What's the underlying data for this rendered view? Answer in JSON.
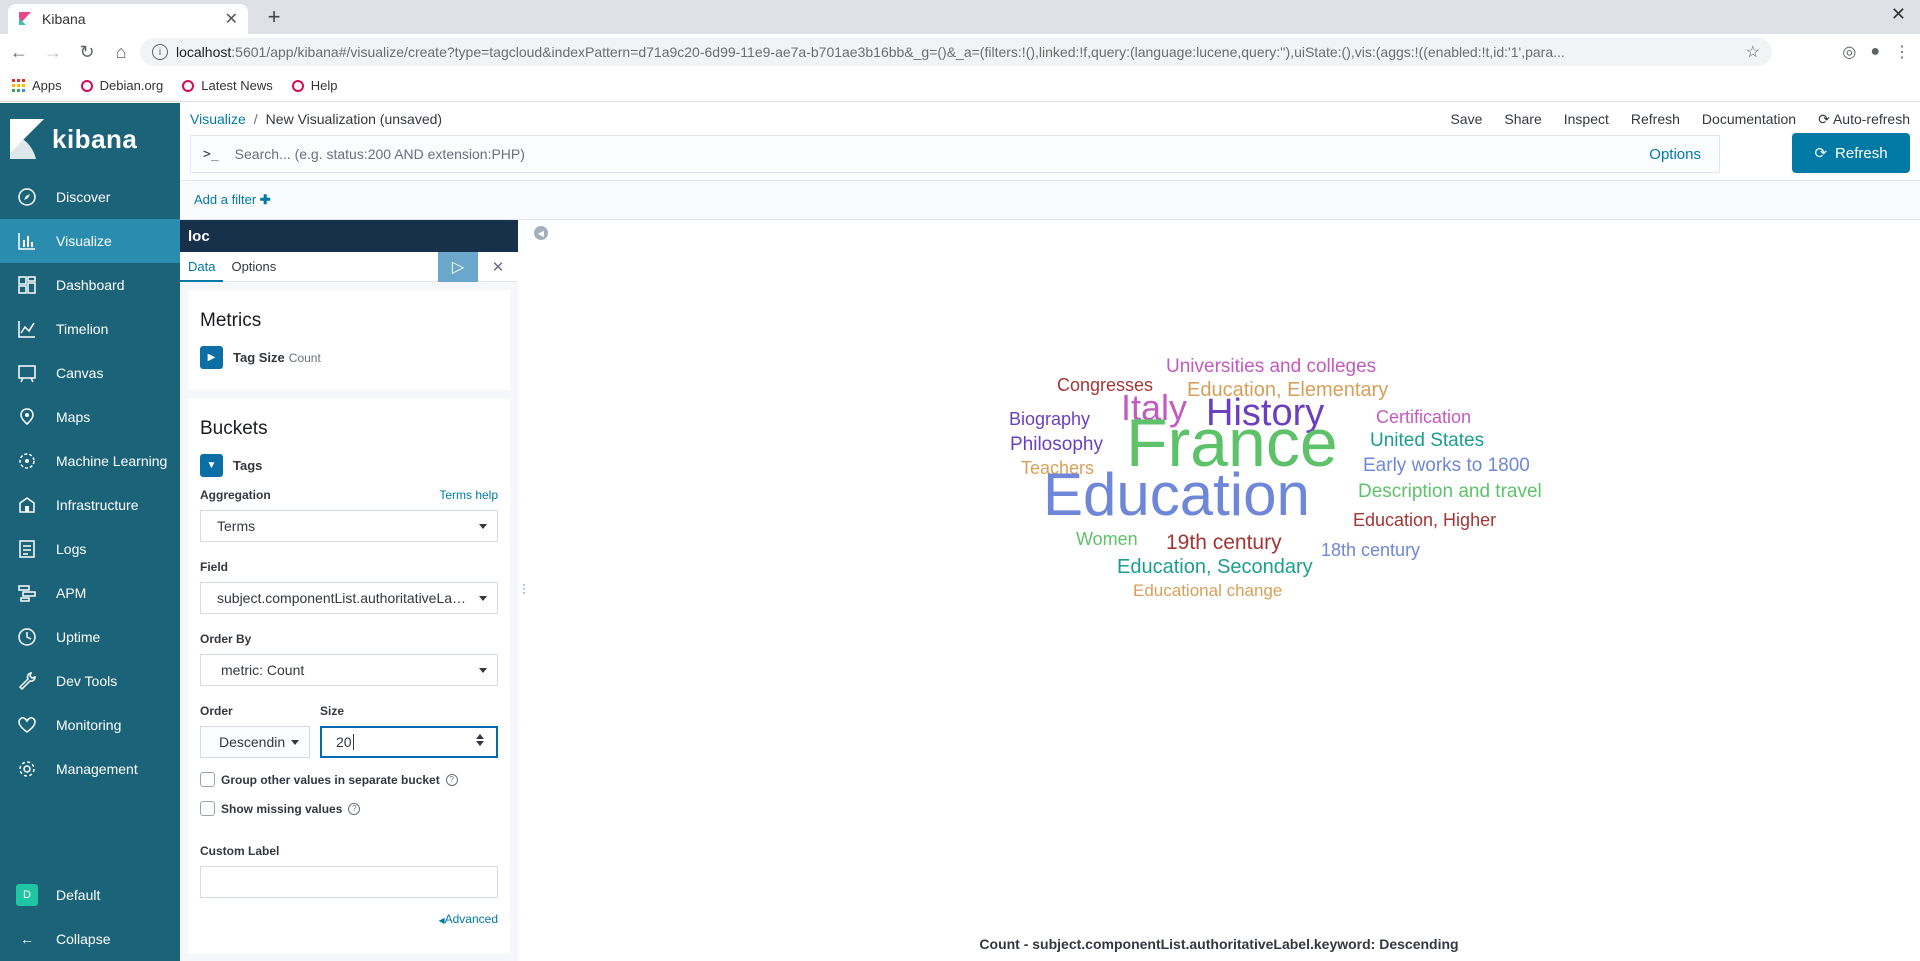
{
  "browser": {
    "tab_title": "Kibana",
    "new_tab": "+",
    "url_host": "localhost",
    "url_rest": ":5601/app/kibana#/visualize/create?type=tagcloud&indexPattern=d71a9c20-6d99-11e9-ae7a-b701ae3b16bb&_g=()&_a=(filters:!(),linked:!f,query:(language:lucene,query:''),uiState:(),vis:(aggs:!((enabled:!t,id:'1',para...",
    "bookmarks": [
      "Apps",
      "Debian.org",
      "Latest News",
      "Help"
    ]
  },
  "kibana": {
    "logo_text": "kibana",
    "nav": [
      {
        "label": "Discover",
        "icon": "compass-icon"
      },
      {
        "label": "Visualize",
        "icon": "visualize-icon"
      },
      {
        "label": "Dashboard",
        "icon": "dashboard-icon"
      },
      {
        "label": "Timelion",
        "icon": "timelion-icon"
      },
      {
        "label": "Canvas",
        "icon": "canvas-icon"
      },
      {
        "label": "Maps",
        "icon": "maps-icon"
      },
      {
        "label": "Machine Learning",
        "icon": "ml-icon"
      },
      {
        "label": "Infrastructure",
        "icon": "infra-icon"
      },
      {
        "label": "Logs",
        "icon": "logs-icon"
      },
      {
        "label": "APM",
        "icon": "apm-icon"
      },
      {
        "label": "Uptime",
        "icon": "uptime-icon"
      },
      {
        "label": "Dev Tools",
        "icon": "wrench-icon"
      },
      {
        "label": "Monitoring",
        "icon": "heartbeat-icon"
      },
      {
        "label": "Management",
        "icon": "gear-icon"
      }
    ],
    "space_label": "Default",
    "space_initial": "D",
    "collapse_label": "Collapse"
  },
  "header": {
    "breadcrumb_root": "Visualize",
    "breadcrumb_sep": "/",
    "breadcrumb_current": "New Visualization (unsaved)",
    "menu": [
      "Save",
      "Share",
      "Inspect",
      "Refresh",
      "Documentation"
    ],
    "auto_refresh": "Auto-refresh",
    "query_prompt": ">_",
    "query_placeholder": "Search... (e.g. status:200 AND extension:PHP)",
    "options": "Options",
    "refresh_button": "Refresh",
    "add_filter": "Add a filter"
  },
  "editor": {
    "index_title": "loc",
    "tabs": [
      "Data",
      "Options"
    ],
    "metrics_heading": "Metrics",
    "metric_label": "Tag Size",
    "metric_agg": "Count",
    "buckets_heading": "Buckets",
    "bucket_label": "Tags",
    "aggregation_label": "Aggregation",
    "terms_help": "Terms help",
    "aggregation_value": "Terms",
    "field_label": "Field",
    "field_value": "subject.componentList.authoritativeLabel.keyword",
    "order_by_label": "Order By",
    "order_by_value": "metric: Count",
    "order_label": "Order",
    "order_value": "Descending",
    "size_label": "Size",
    "size_value": "20",
    "group_other_label": "Group other values in separate bucket",
    "show_missing_label": "Show missing values",
    "custom_label_label": "Custom Label",
    "custom_label_value": "",
    "advanced_link": "Advanced"
  },
  "tagcloud": {
    "words": [
      {
        "text": "Universities and colleges",
        "color": "#c35ac0"
      },
      {
        "text": "Congresses",
        "color": "#a33535"
      },
      {
        "text": "Education, Elementary",
        "color": "#d6a05a"
      },
      {
        "text": "Italy",
        "color": "#c35ac0"
      },
      {
        "text": "History",
        "color": "#6c3fbf"
      },
      {
        "text": "Biography",
        "color": "#6c3fbf"
      },
      {
        "text": "Certification",
        "color": "#c35ac0"
      },
      {
        "text": "United States",
        "color": "#1b9e91"
      },
      {
        "text": "Philosophy",
        "color": "#6c3fbf"
      },
      {
        "text": "France",
        "color": "#5ec26a"
      },
      {
        "text": "Teachers",
        "color": "#d6a05a"
      },
      {
        "text": "Early works to 1800",
        "color": "#6f87d8"
      },
      {
        "text": "Description and travel",
        "color": "#5ec26a"
      },
      {
        "text": "Education",
        "color": "#6f87d8"
      },
      {
        "text": "Education, Higher",
        "color": "#a33535"
      },
      {
        "text": "Women",
        "color": "#5ec26a"
      },
      {
        "text": "19th century",
        "color": "#a33535"
      },
      {
        "text": "18th century",
        "color": "#6f87d8"
      },
      {
        "text": "Education, Secondary",
        "color": "#1b9e91"
      },
      {
        "text": "Educational change",
        "color": "#d6a05a"
      }
    ],
    "caption": "Count - subject.componentList.authoritativeLabel.keyword: Descending"
  },
  "colors": {
    "nav_bg": "#1b6378",
    "nav_active": "#2a8db0",
    "accent": "#0079a5",
    "editor_title_bg": "#18314b"
  }
}
